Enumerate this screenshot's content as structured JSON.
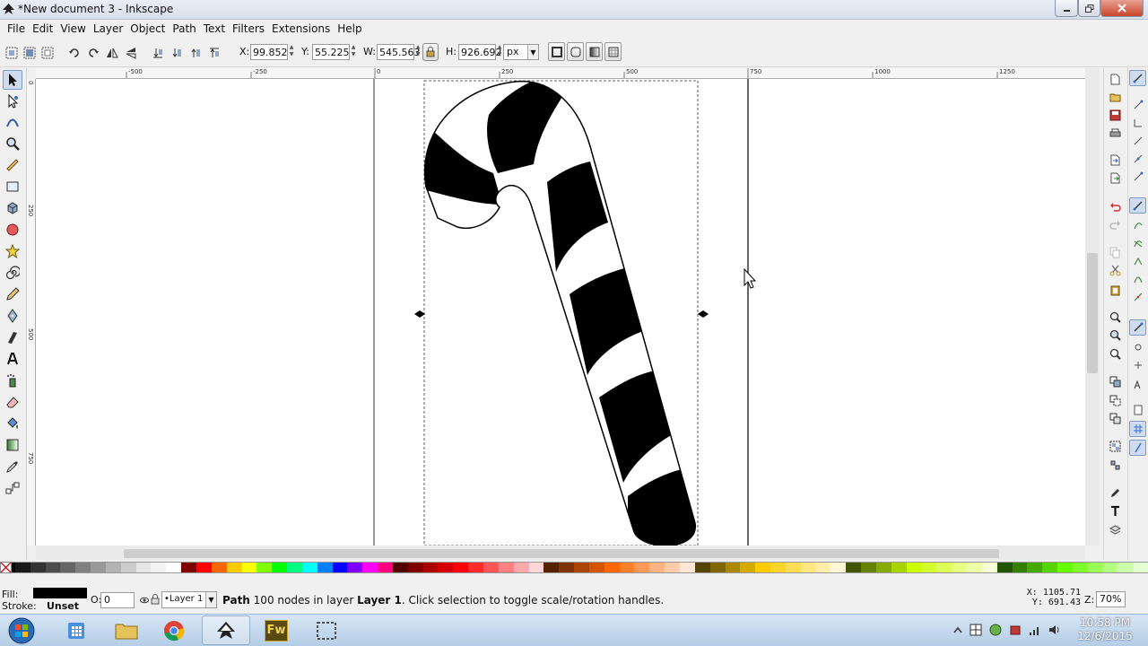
{
  "window": {
    "title": "*New document 3 - Inkscape"
  },
  "menu": [
    "File",
    "Edit",
    "View",
    "Layer",
    "Object",
    "Path",
    "Text",
    "Filters",
    "Extensions",
    "Help"
  ],
  "tool_controls": {
    "x_label": "X:",
    "x_value": "99.852",
    "y_label": "Y:",
    "y_value": "55.225",
    "w_label": "W:",
    "w_value": "545.563",
    "h_label": "H:",
    "h_value": "926.692",
    "unit": "px"
  },
  "rulers": {
    "horizontal": [
      "-500",
      "-250",
      "0",
      "250",
      "500",
      "750",
      "1000",
      "1250"
    ],
    "vertical": [
      "0",
      "250",
      "500",
      "750"
    ]
  },
  "status": {
    "fill_label": "Fill:",
    "stroke_label": "Stroke:",
    "stroke_value": "Unset",
    "opacity_label": "O:",
    "opacity_value": "0",
    "layer": "•Layer 1",
    "message_prefix": "Path",
    "message_middle": " 100 nodes in layer ",
    "message_layer": "Layer 1",
    "message_suffix": ". Click selection to toggle scale/rotation handles.",
    "coord_x": "X: 1105.71",
    "coord_y": "Y:  691.43",
    "zoom_label": "Z:",
    "zoom_value": "70%"
  },
  "taskbar": {
    "time": "10:58 PM",
    "date": "12/6/2015",
    "fireworks_label": "Fw"
  },
  "colors": {
    "palette": [
      "#000000",
      "#1a1a1a",
      "#333333",
      "#4d4d4d",
      "#666666",
      "#808080",
      "#999999",
      "#b3b3b3",
      "#cccccc",
      "#e6e6e6",
      "#f2f2f2",
      "#ffffff",
      "#800000",
      "#ff0000",
      "#ff6600",
      "#ffcc00",
      "#ffff00",
      "#80ff00",
      "#00ff00",
      "#00ff80",
      "#00ffff",
      "#0080ff",
      "#0000ff",
      "#8000ff",
      "#ff00ff",
      "#ff0080",
      "#550000",
      "#800000",
      "#aa0000",
      "#d40000",
      "#ff0000",
      "#ff2a2a",
      "#ff5555",
      "#ff8080",
      "#ffaaaa",
      "#ffd5d5",
      "#552200",
      "#803300",
      "#aa4400",
      "#d45500",
      "#ff6600",
      "#ff7f2a",
      "#ff9955",
      "#ffb380",
      "#ffccaa",
      "#ffe6d5",
      "#554400",
      "#806600",
      "#aa8800",
      "#d4aa00",
      "#ffcc00",
      "#ffd42a",
      "#ffdd55",
      "#ffe680",
      "#ffeeaa",
      "#fff6d5",
      "#445500",
      "#668000",
      "#88aa00",
      "#aad400",
      "#ccff00",
      "#d4ff2a",
      "#ddff55",
      "#e5ff80",
      "#eeffaa",
      "#f6ffd5",
      "#225500",
      "#338000",
      "#44aa00",
      "#55d400",
      "#66ff00",
      "#7fff2a",
      "#99ff55",
      "#b3ff80",
      "#ccffaa",
      "#e5ffd5"
    ],
    "taskbar_bg": "#c3d7ec"
  }
}
